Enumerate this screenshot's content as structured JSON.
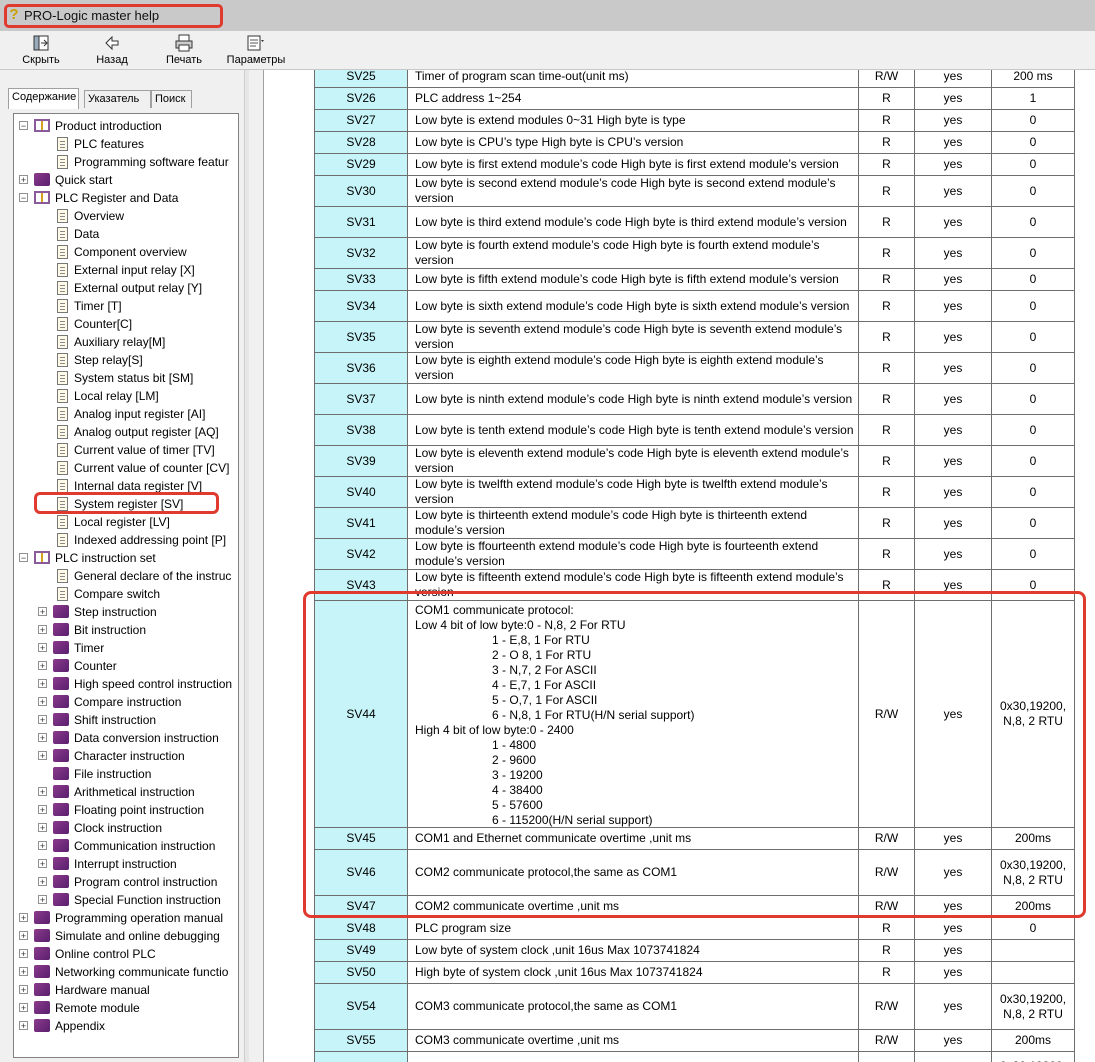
{
  "window": {
    "title": "PRO-Logic master help"
  },
  "toolbar": {
    "buttons": [
      {
        "label": "Скрыть",
        "icon": "hide-icon"
      },
      {
        "label": "Назад",
        "icon": "back-arrow-icon"
      },
      {
        "label": "Печать",
        "icon": "printer-icon"
      },
      {
        "label": "Параметры",
        "icon": "options-icon"
      }
    ]
  },
  "tabs": [
    "Содержание",
    "Указатель",
    "Поиск"
  ],
  "tree": [
    {
      "label": "Product introduction",
      "type": "open",
      "level": 0,
      "toggle": "minus"
    },
    {
      "label": "PLC features",
      "type": "page",
      "level": 1
    },
    {
      "label": "Programming software featur",
      "type": "page",
      "level": 1
    },
    {
      "label": "Quick start",
      "type": "closed",
      "level": 0,
      "toggle": "plus"
    },
    {
      "label": "PLC Register and Data",
      "type": "open",
      "level": 0,
      "toggle": "minus"
    },
    {
      "label": "Overview",
      "type": "page",
      "level": 1
    },
    {
      "label": "Data",
      "type": "page",
      "level": 1
    },
    {
      "label": "Component overview",
      "type": "page",
      "level": 1
    },
    {
      "label": "External input relay [X]",
      "type": "page",
      "level": 1
    },
    {
      "label": "External output relay [Y]",
      "type": "page",
      "level": 1
    },
    {
      "label": "Timer [T]",
      "type": "page",
      "level": 1
    },
    {
      "label": "Counter[C]",
      "type": "page",
      "level": 1
    },
    {
      "label": "Auxiliary relay[M]",
      "type": "page",
      "level": 1
    },
    {
      "label": "Step relay[S]",
      "type": "page",
      "level": 1
    },
    {
      "label": "System status bit [SM]",
      "type": "page",
      "level": 1
    },
    {
      "label": "Local relay [LM]",
      "type": "page",
      "level": 1
    },
    {
      "label": "Analog input register [AI]",
      "type": "page",
      "level": 1
    },
    {
      "label": "Analog output register [AQ]",
      "type": "page",
      "level": 1
    },
    {
      "label": "Current value of timer [TV]",
      "type": "page",
      "level": 1
    },
    {
      "label": "Current value of counter [CV]",
      "type": "page",
      "level": 1
    },
    {
      "label": "Internal data register [V]",
      "type": "page",
      "level": 1
    },
    {
      "label": "System register [SV]",
      "type": "page",
      "level": 1
    },
    {
      "label": "Local register [LV]",
      "type": "page",
      "level": 1
    },
    {
      "label": "Indexed addressing point [P]",
      "type": "page",
      "level": 1
    },
    {
      "label": "PLC instruction set",
      "type": "open",
      "level": 0,
      "toggle": "minus"
    },
    {
      "label": "General declare of the instruc",
      "type": "page",
      "level": 1
    },
    {
      "label": "Compare switch",
      "type": "page",
      "level": 1
    },
    {
      "label": "Step instruction",
      "type": "closed",
      "level": 1,
      "toggle": "plus"
    },
    {
      "label": "Bit instruction",
      "type": "closed",
      "level": 1,
      "toggle": "plus"
    },
    {
      "label": "Timer",
      "type": "closed",
      "level": 1,
      "toggle": "plus"
    },
    {
      "label": "Counter",
      "type": "closed",
      "level": 1,
      "toggle": "plus"
    },
    {
      "label": "High speed control instruction",
      "type": "closed",
      "level": 1,
      "toggle": "plus"
    },
    {
      "label": "Compare  instruction",
      "type": "closed",
      "level": 1,
      "toggle": "plus"
    },
    {
      "label": "Shift  instruction",
      "type": "closed",
      "level": 1,
      "toggle": "plus"
    },
    {
      "label": "Data conversion instruction",
      "type": "closed",
      "level": 1,
      "toggle": "plus"
    },
    {
      "label": "Character instruction",
      "type": "closed",
      "level": 1,
      "toggle": "plus"
    },
    {
      "label": "File instruction",
      "type": "closed",
      "level": 1
    },
    {
      "label": "Arithmetical instruction",
      "type": "closed",
      "level": 1,
      "toggle": "plus"
    },
    {
      "label": "Floating point instruction",
      "type": "closed",
      "level": 1,
      "toggle": "plus"
    },
    {
      "label": "Clock instruction",
      "type": "closed",
      "level": 1,
      "toggle": "plus"
    },
    {
      "label": "Communication instruction",
      "type": "closed",
      "level": 1,
      "toggle": "plus"
    },
    {
      "label": "Interrupt instruction",
      "type": "closed",
      "level": 1,
      "toggle": "plus"
    },
    {
      "label": "Program control  instruction",
      "type": "closed",
      "level": 1,
      "toggle": "plus"
    },
    {
      "label": "Special Function  instruction",
      "type": "closed",
      "level": 1,
      "toggle": "plus"
    },
    {
      "label": "Programming operation manual",
      "type": "closed",
      "level": 0,
      "toggle": "plus"
    },
    {
      "label": "Simulate and online debugging",
      "type": "closed",
      "level": 0,
      "toggle": "plus"
    },
    {
      "label": "Online control PLC",
      "type": "closed",
      "level": 0,
      "toggle": "plus"
    },
    {
      "label": "Networking communicate functio",
      "type": "closed",
      "level": 0,
      "toggle": "plus"
    },
    {
      "label": "Hardware manual",
      "type": "closed",
      "level": 0,
      "toggle": "plus"
    },
    {
      "label": "Remote module",
      "type": "closed",
      "level": 0,
      "toggle": "plus"
    },
    {
      "label": "Appendix",
      "type": "closed",
      "level": 0,
      "toggle": "plus"
    }
  ],
  "table": {
    "rows": [
      {
        "reg": "SV25",
        "desc": "Timer of program scan time-out(unit ms)",
        "rw": "R/W",
        "keep": "yes",
        "def": "200 ms",
        "h": 22
      },
      {
        "reg": "SV26",
        "desc": "PLC address 1~254",
        "rw": "R",
        "keep": "yes",
        "def": "1",
        "h": 22
      },
      {
        "reg": "SV27",
        "desc": "Low byte is extend modules 0~31 High byte is type",
        "rw": "R",
        "keep": "yes",
        "def": "0",
        "h": 22
      },
      {
        "reg": "SV28",
        "desc": "Low byte is CPU’s type High byte is CPU’s version",
        "rw": "R",
        "keep": "yes",
        "def": "0",
        "h": 22
      },
      {
        "reg": "SV29",
        "desc": "Low byte is first extend module’s code High byte is first extend module’s version",
        "rw": "R",
        "keep": "yes",
        "def": "0",
        "h": 22
      },
      {
        "reg": "SV30",
        "desc": "Low byte is second extend module’s code High byte is second extend module’s version",
        "rw": "R",
        "keep": "yes",
        "def": "0",
        "h": 31
      },
      {
        "reg": "SV31",
        "desc": "Low byte is third extend module’s code High byte is third extend module’s version",
        "rw": "R",
        "keep": "yes",
        "def": "0",
        "h": 31
      },
      {
        "reg": "SV32",
        "desc": "Low byte is fourth extend module’s code High byte is fourth extend module’s version",
        "rw": "R",
        "keep": "yes",
        "def": "0",
        "h": 31
      },
      {
        "reg": "SV33",
        "desc": "Low byte is fifth extend module’s code High byte is fifth extend module’s version",
        "rw": "R",
        "keep": "yes",
        "def": "0",
        "h": 22
      },
      {
        "reg": "SV34",
        "desc": "Low byte is sixth extend module’s code High byte is sixth extend module’s version",
        "rw": "R",
        "keep": "yes",
        "def": "0",
        "h": 31
      },
      {
        "reg": "SV35",
        "desc": "Low byte is seventh extend module’s code High byte is seventh extend module’s version",
        "rw": "R",
        "keep": "yes",
        "def": "0",
        "h": 31
      },
      {
        "reg": "SV36",
        "desc": "Low byte is eighth extend module’s code High byte is eighth extend module’s version",
        "rw": "R",
        "keep": "yes",
        "def": "0",
        "h": 31
      },
      {
        "reg": "SV37",
        "desc": "Low byte is ninth extend module’s code High byte is ninth extend module’s version",
        "rw": "R",
        "keep": "yes",
        "def": "0",
        "h": 31
      },
      {
        "reg": "SV38",
        "desc": "Low byte is tenth extend module’s code High byte is tenth extend module’s version",
        "rw": "R",
        "keep": "yes",
        "def": "0",
        "h": 31
      },
      {
        "reg": "SV39",
        "desc": "Low byte is eleventh extend module’s code High byte is eleventh extend module’s version",
        "rw": "R",
        "keep": "yes",
        "def": "0",
        "h": 31
      },
      {
        "reg": "SV40",
        "desc": "Low byte is twelfth extend module’s code High byte is twelfth extend module’s version",
        "rw": "R",
        "keep": "yes",
        "def": "0",
        "h": 31
      },
      {
        "reg": "SV41",
        "desc": "Low byte is thirteenth extend module’s code High byte is thirteenth  extend module’s version",
        "rw": "R",
        "keep": "yes",
        "def": "0",
        "h": 31
      },
      {
        "reg": "SV42",
        "desc": "Low byte is ffourteenth extend module’s code High byte is fourteenth extend module’s version",
        "rw": "R",
        "keep": "yes",
        "def": "0",
        "h": 31
      },
      {
        "reg": "SV43",
        "desc": "Low byte is fifteenth extend module’s code High byte is fifteenth extend module’s version",
        "rw": "R",
        "keep": "yes",
        "def": "0",
        "h": 31
      },
      {
        "reg": "SV44",
        "lines": [
          "COM1 communicate protocol:",
          "Low 4 bit of low byte:0 - N,8, 2 For RTU",
          "1 - E,8, 1 For RTU",
          "2 - O 8, 1 For RTU",
          "3 - N,7, 2 For ASCII",
          "4 - E,7, 1 For ASCII",
          "5 - O,7, 1 For ASCII",
          "6 - N,8, 1 For RTU(H/N serial support)",
          "High 4 bit of low byte:0 - 2400",
          "1 - 4800",
          "2 - 9600",
          "3 - 19200",
          "4 - 38400",
          "5 - 57600",
          "6 - 115200(H/N serial support)"
        ],
        "rw": "R/W",
        "keep": "yes",
        "def": "0x30,19200, N,8, 2 RTU",
        "h": 227
      },
      {
        "reg": "SV45",
        "desc": "COM1 and Ethernet communicate overtime ,unit ms",
        "rw": "R/W",
        "keep": "yes",
        "def": "200ms",
        "h": 22
      },
      {
        "reg": "SV46",
        "desc": "COM2 communicate protocol,the same as COM1",
        "rw": "R/W",
        "keep": "yes",
        "def": "0x30,19200, N,8, 2 RTU",
        "h": 46
      },
      {
        "reg": "SV47",
        "desc": "COM2 communicate overtime ,unit ms",
        "rw": "R/W",
        "keep": "yes",
        "def": "200ms",
        "h": 22
      },
      {
        "reg": "SV48",
        "desc": "PLC program size",
        "rw": "R",
        "keep": "yes",
        "def": "0",
        "h": 22
      },
      {
        "reg": "SV49",
        "desc": "Low byte of system clock ,unit 16us Max 1073741824",
        "rw": "R",
        "keep": "yes",
        "def": "",
        "h": 22
      },
      {
        "reg": "SV50",
        "desc": "High byte of system clock ,unit 16us Max 1073741824",
        "rw": "R",
        "keep": "yes",
        "def": "",
        "h": 22
      },
      {
        "reg": "SV54",
        "desc": "COM3 communicate protocol,the same as COM1",
        "rw": "R/W",
        "keep": "yes",
        "def": "0x30,19200, N,8, 2 RTU",
        "h": 46
      },
      {
        "reg": "SV55",
        "desc": "COM3 communicate overtime ,unit ms",
        "rw": "R/W",
        "keep": "yes",
        "def": "200ms",
        "h": 22
      },
      {
        "reg": "",
        "desc": "",
        "rw": "",
        "keep": "",
        "def": "0x30,19200,",
        "h": 30
      }
    ]
  }
}
